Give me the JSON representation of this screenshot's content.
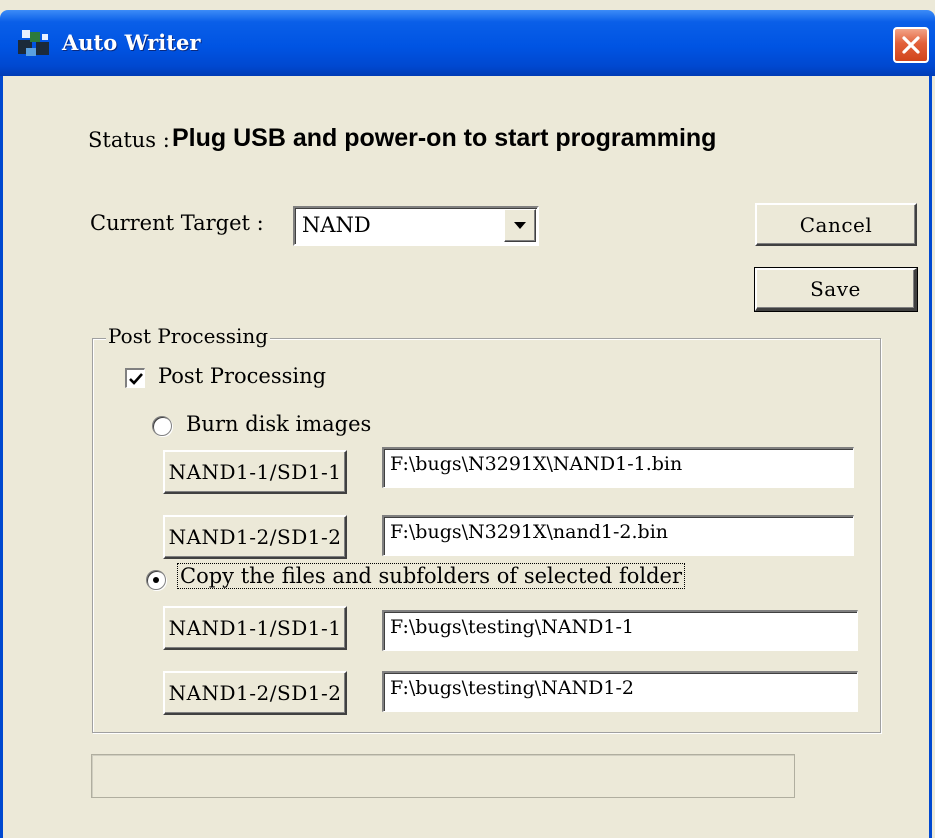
{
  "window": {
    "title": "Auto Writer",
    "icon": "app-icon",
    "close_icon": "close-icon"
  },
  "status": {
    "label": "Status :",
    "value": "Plug USB and power-on to start programming"
  },
  "target": {
    "label": "Current Target :",
    "selected": "NAND"
  },
  "buttons": {
    "cancel": "Cancel",
    "save": "Save"
  },
  "post_processing": {
    "group_label": "Post Processing",
    "checkbox_label": "Post Processing",
    "checked": true,
    "burn": {
      "label": "Burn disk images",
      "selected": false,
      "rows": [
        {
          "button": "NAND1-1/SD1-1",
          "path": "F:\\bugs\\N3291X\\NAND1-1.bin"
        },
        {
          "button": "NAND1-2/SD1-2",
          "path": "F:\\bugs\\N3291X\\nand1-2.bin"
        }
      ]
    },
    "copy": {
      "label": "Copy the files and subfolders of selected folder",
      "selected": true,
      "rows": [
        {
          "button": "NAND1-1/SD1-1",
          "path": "F:\\bugs\\testing\\NAND1-1"
        },
        {
          "button": "NAND1-2/SD1-2",
          "path": "F:\\bugs\\testing\\NAND1-2"
        }
      ]
    }
  },
  "progress": {
    "value": 0
  },
  "colors": {
    "titlebar": "#0054e3",
    "face": "#ece9d8",
    "close": "#e2603a"
  }
}
